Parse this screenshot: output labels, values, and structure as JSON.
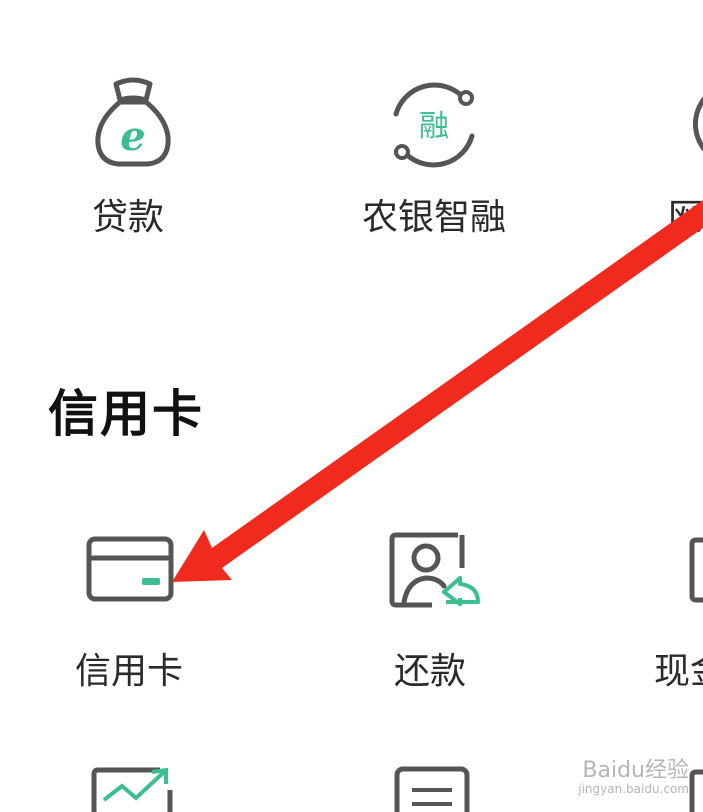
{
  "colors": {
    "icon_stroke": "#555555",
    "icon_accent": "#3bbf91",
    "arrow": "#f02a1c",
    "text": "#2a2a2a"
  },
  "row1": {
    "loan_label": "贷款",
    "loan_icon_glyph": "e",
    "zhirong_label": "农银智融",
    "zhirong_icon_glyph": "融",
    "third_label_partial": "网"
  },
  "section": {
    "title": "信用卡"
  },
  "row2": {
    "credit_card_label": "信用卡",
    "repay_label": "还款",
    "third_label_partial": "现金"
  },
  "watermark": {
    "text": "Baidu经验",
    "url": "jingyan.baidu.com"
  }
}
